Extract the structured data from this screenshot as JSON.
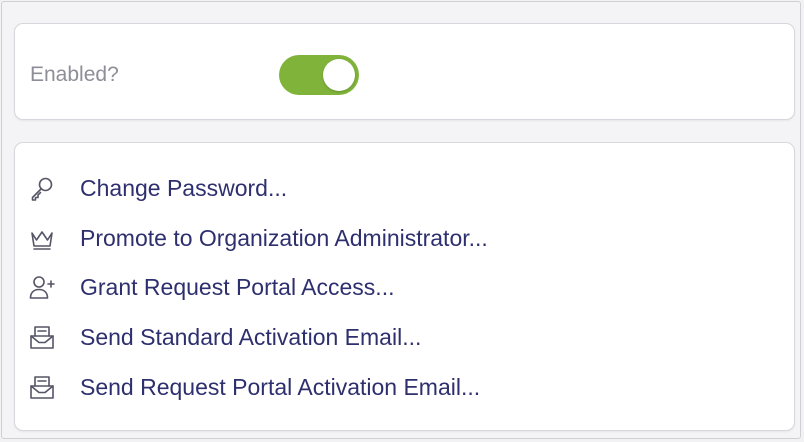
{
  "enabled_card": {
    "label": "Enabled?",
    "toggle_on": true,
    "toggle_color": "#7fb33a"
  },
  "actions": [
    {
      "label": "Change Password...",
      "icon": "key-icon"
    },
    {
      "label": "Promote to Organization Administrator...",
      "icon": "crown-icon"
    },
    {
      "label": "Grant Request Portal Access...",
      "icon": "user-plus-icon"
    },
    {
      "label": "Send Standard Activation Email...",
      "icon": "mail-inbox-icon"
    },
    {
      "label": "Send Request Portal Activation Email...",
      "icon": "mail-inbox-icon"
    }
  ],
  "colors": {
    "action_text": "#2e2f6e",
    "label_text": "#8e8e98"
  }
}
